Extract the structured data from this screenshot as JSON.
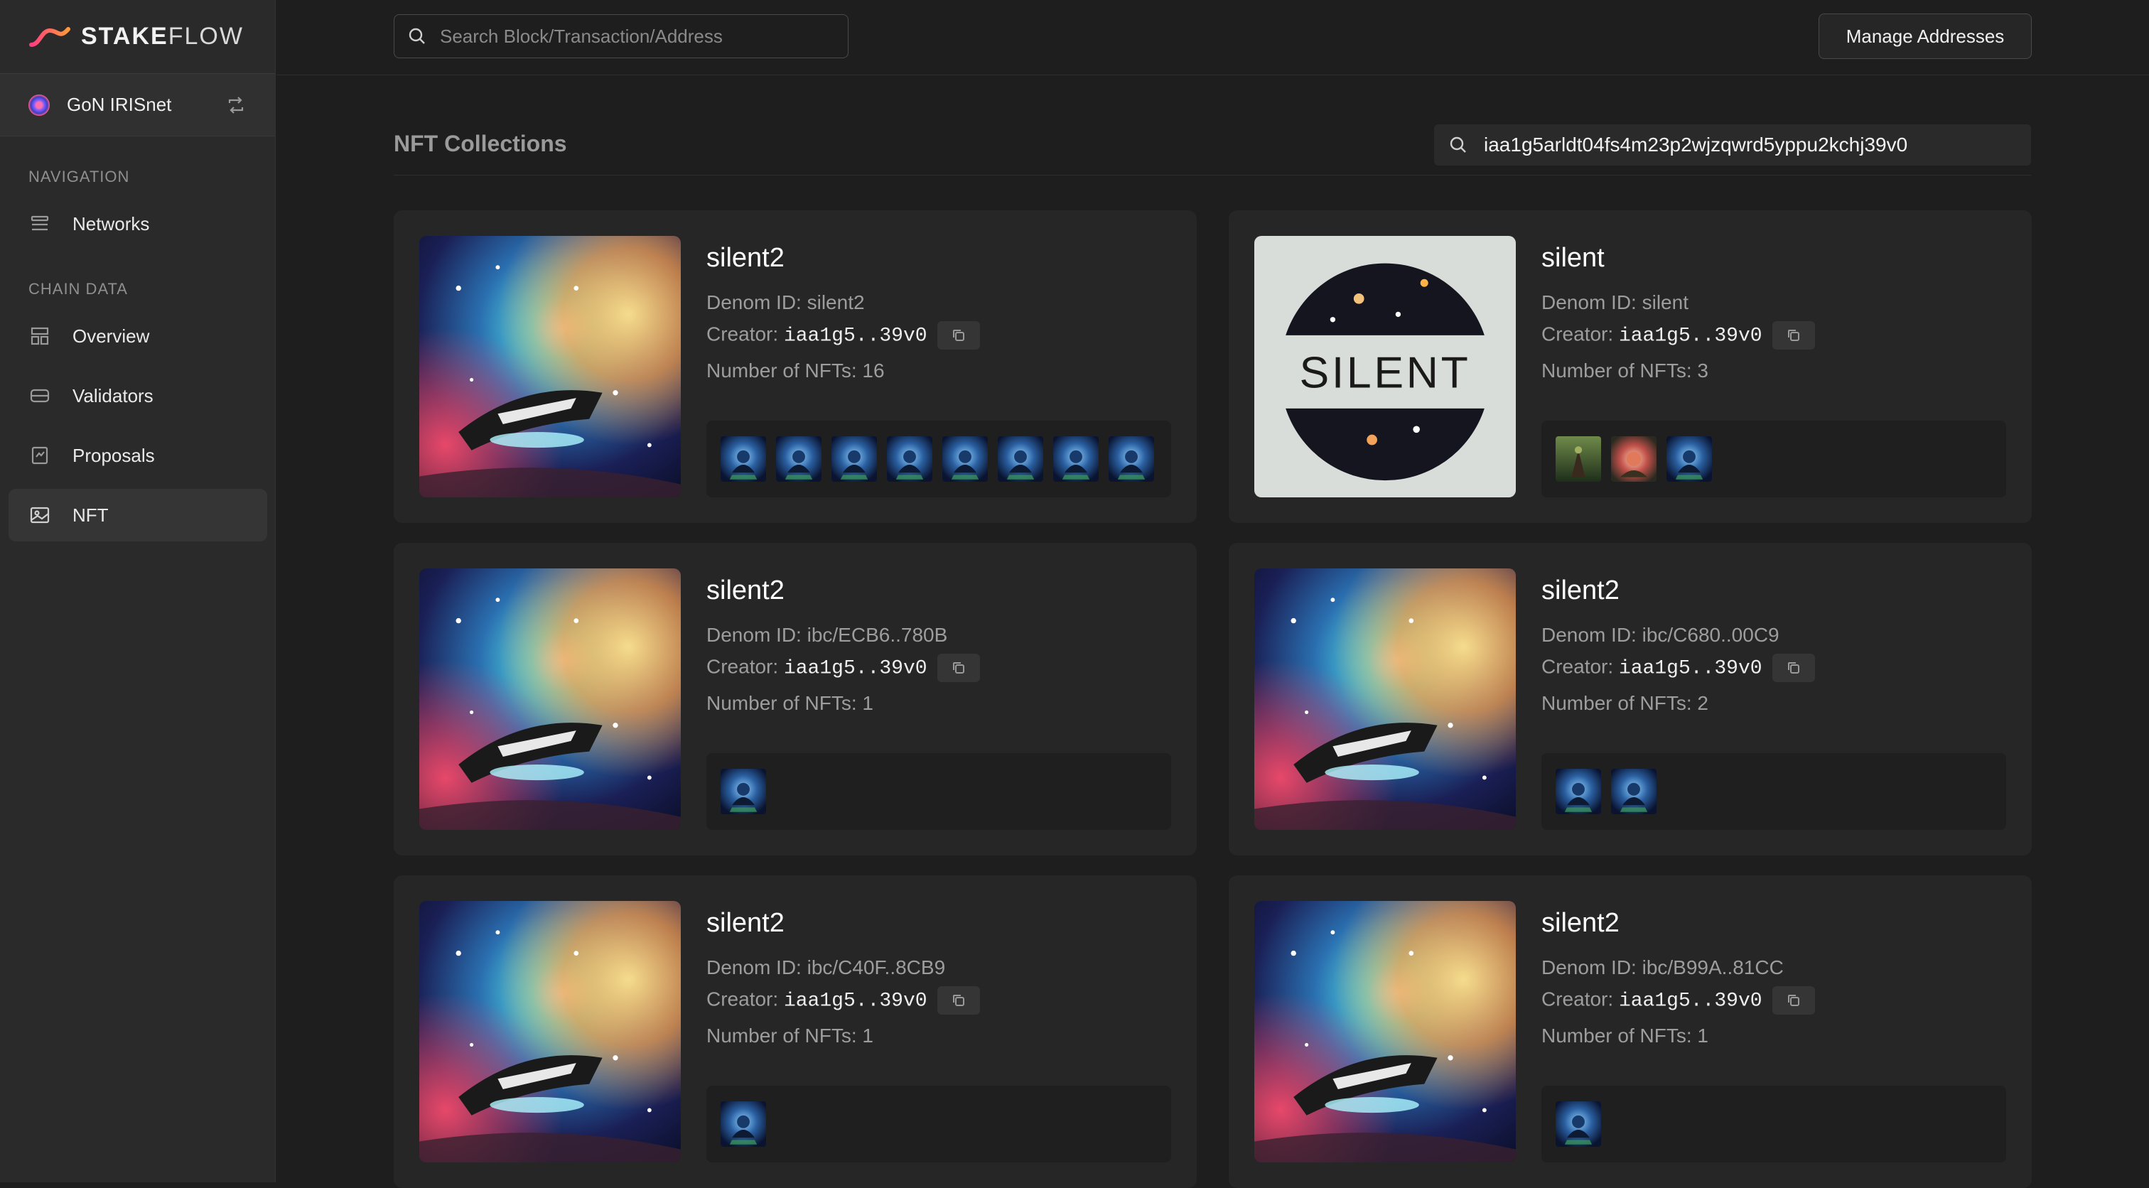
{
  "brand": {
    "name_bold": "STAKE",
    "name_light": "FLOW"
  },
  "network": {
    "name": "GoN IRISnet"
  },
  "sidebar": {
    "sections": [
      "NAVIGATION",
      "CHAIN DATA"
    ],
    "items": [
      {
        "label": "Networks"
      },
      {
        "label": "Overview"
      },
      {
        "label": "Validators"
      },
      {
        "label": "Proposals"
      },
      {
        "label": "NFT"
      }
    ]
  },
  "topbar": {
    "search_placeholder": "Search Block/Transaction/Address",
    "manage_label": "Manage Addresses"
  },
  "collections": {
    "title": "NFT Collections",
    "address_filter": "iaa1g5arldt04fs4m23p2wjzqwrd5yppu2kchj39v0",
    "denom_label": "Denom ID: ",
    "creator_label": "Creator: ",
    "count_label": "Number of NFTs: ",
    "cards": [
      {
        "name": "silent2",
        "denom": "silent2",
        "creator": "iaa1g5..39v0",
        "count": "16",
        "cover": "space",
        "thumbs": [
          "blue",
          "blue",
          "blue",
          "blue",
          "blue",
          "blue",
          "blue",
          "blue"
        ]
      },
      {
        "name": "silent",
        "denom": "silent",
        "creator": "iaa1g5..39v0",
        "count": "3",
        "cover": "silent-logo",
        "thumbs": [
          "green",
          "red",
          "blue"
        ]
      },
      {
        "name": "silent2",
        "denom": "ibc/ECB6..780B",
        "creator": "iaa1g5..39v0",
        "count": "1",
        "cover": "space",
        "thumbs": [
          "blue"
        ]
      },
      {
        "name": "silent2",
        "denom": "ibc/C680..00C9",
        "creator": "iaa1g5..39v0",
        "count": "2",
        "cover": "space",
        "thumbs": [
          "blue",
          "blue"
        ]
      },
      {
        "name": "silent2",
        "denom": "ibc/C40F..8CB9",
        "creator": "iaa1g5..39v0",
        "count": "1",
        "cover": "space",
        "thumbs": [
          "blue"
        ]
      },
      {
        "name": "silent2",
        "denom": "ibc/B99A..81CC",
        "creator": "iaa1g5..39v0",
        "count": "1",
        "cover": "space",
        "thumbs": [
          "blue"
        ]
      }
    ],
    "cover_logo_text": "SILENT"
  },
  "colors": {
    "background": "#1e1e1e",
    "sidebar": "#2a2a2a",
    "card": "#262626",
    "accent_gradient": [
      "#ff4d8d",
      "#ff9a3c"
    ]
  }
}
